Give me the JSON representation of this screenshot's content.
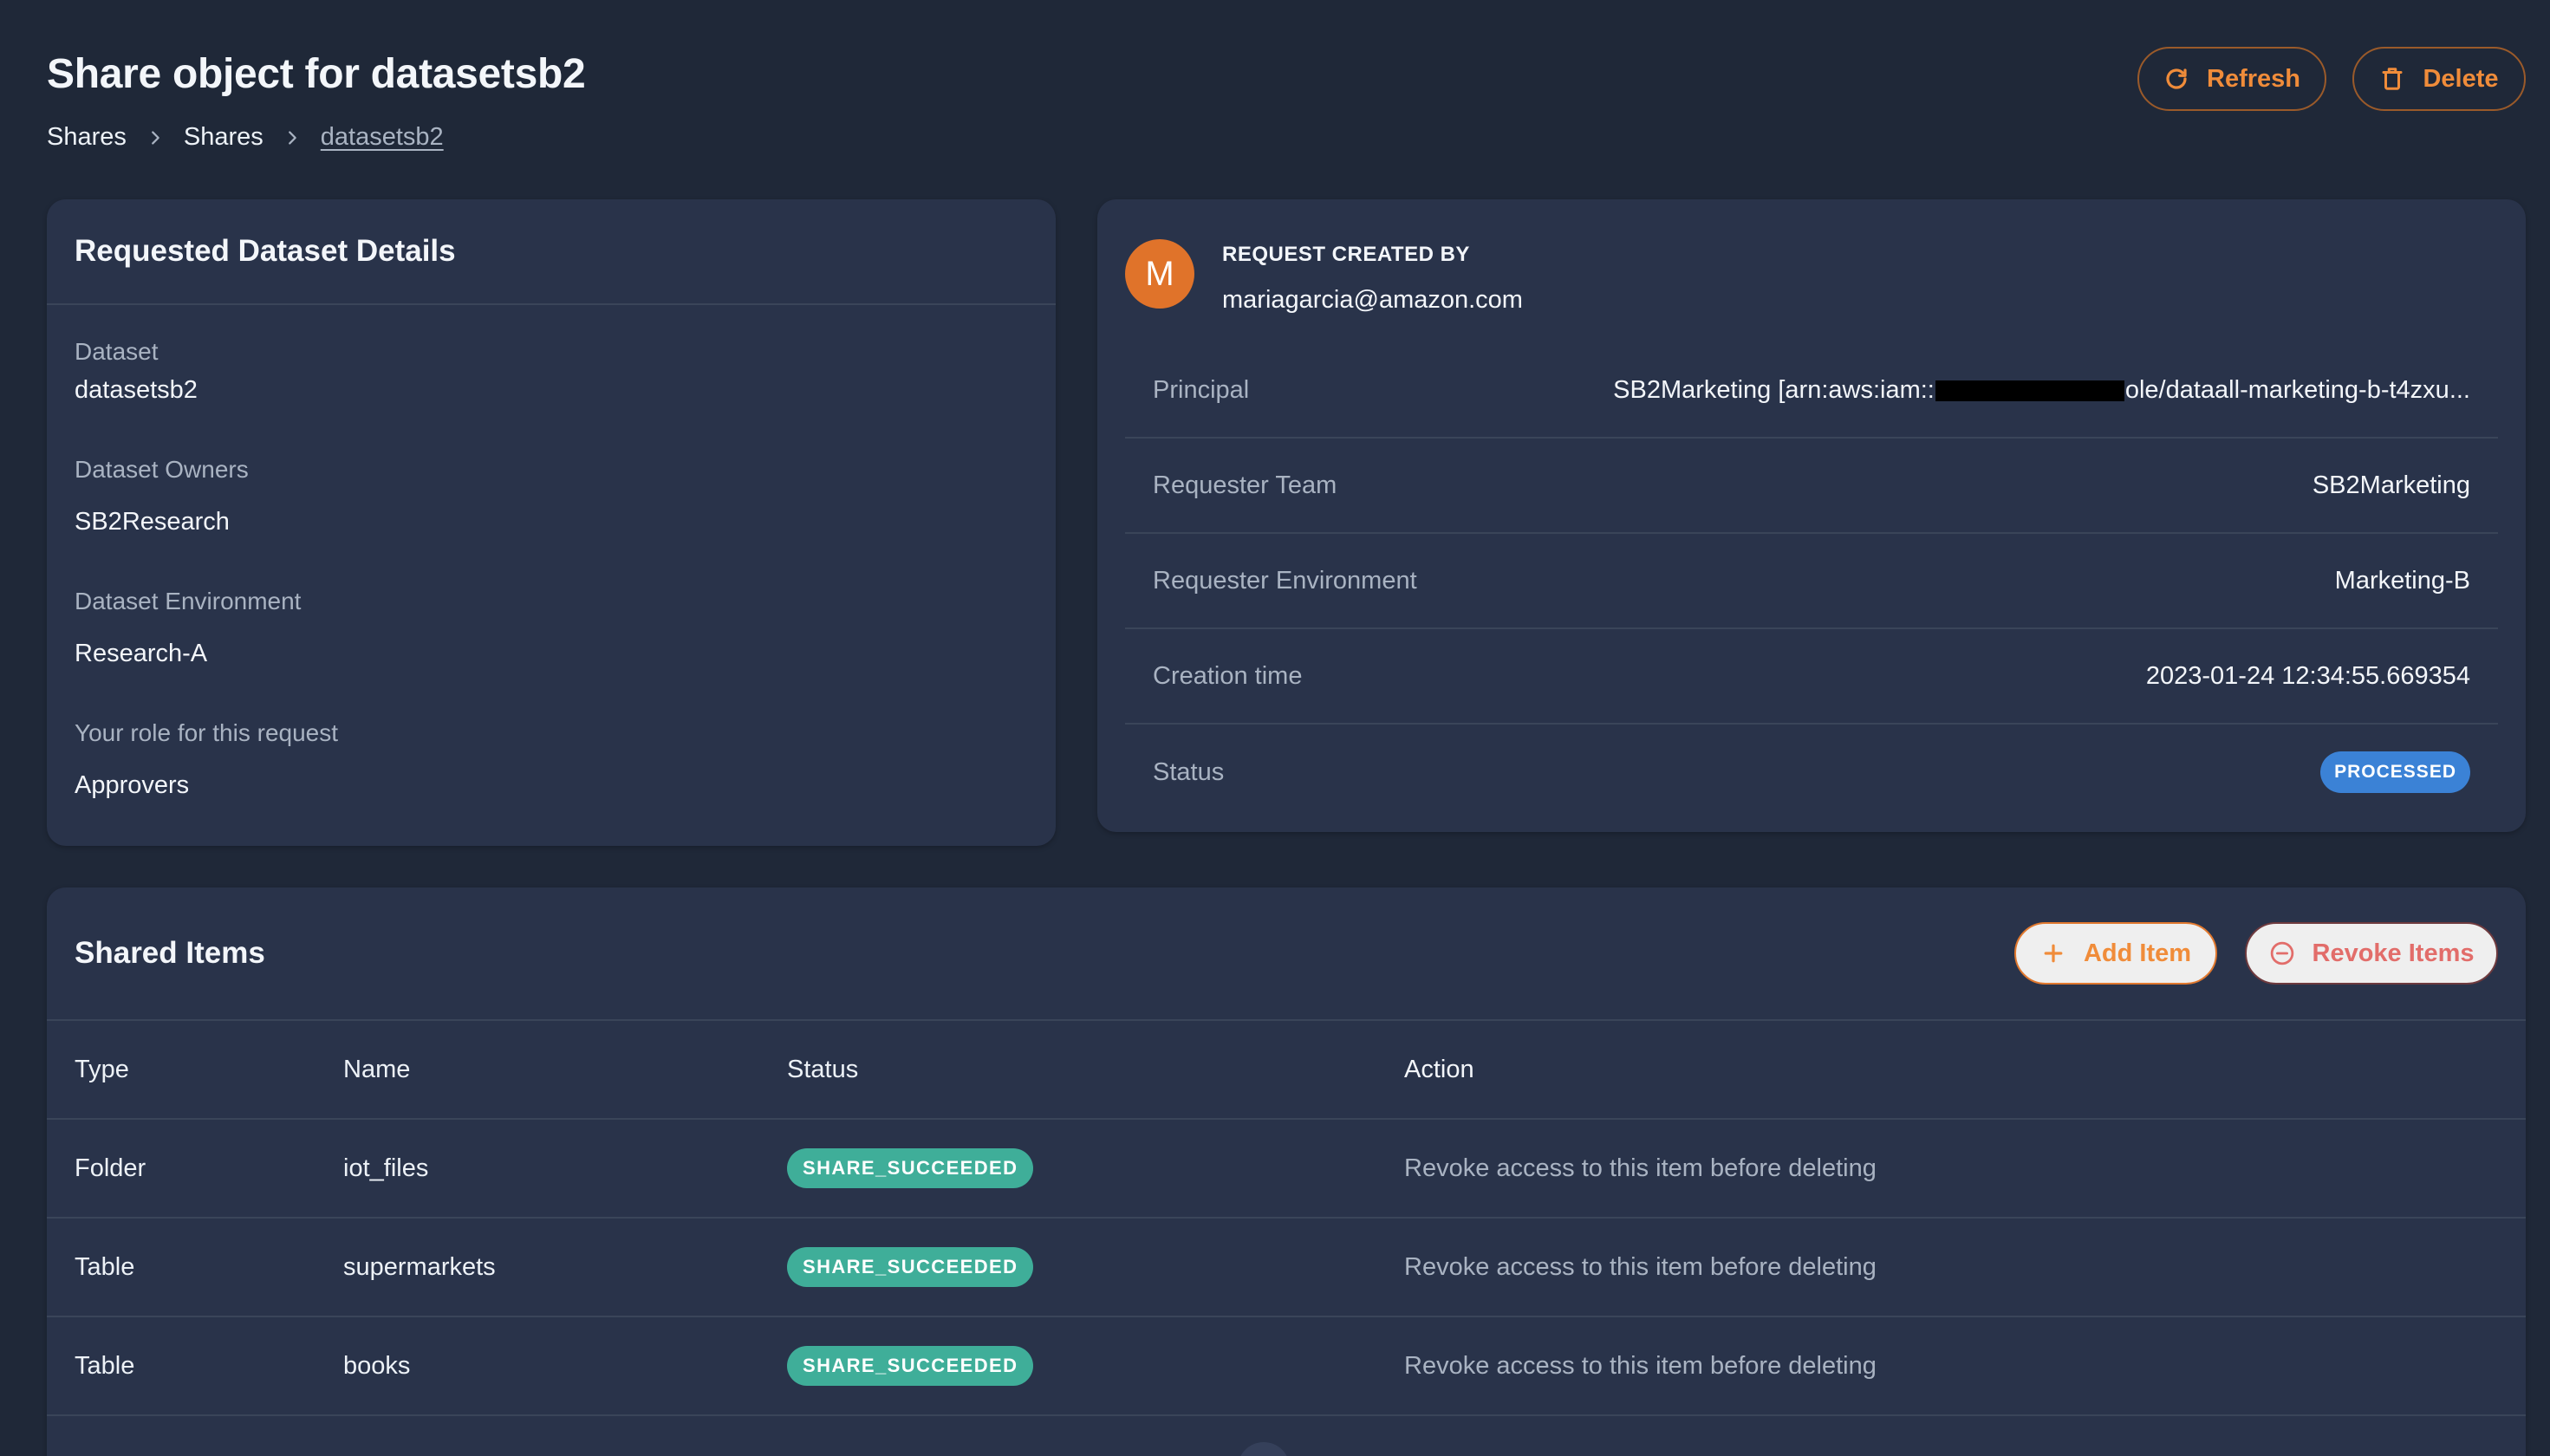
{
  "header": {
    "title": "Share object for datasetsb2",
    "breadcrumb": [
      "Shares",
      "Shares",
      "datasetsb2"
    ],
    "refresh_label": "Refresh",
    "delete_label": "Delete"
  },
  "details": {
    "title": "Requested Dataset Details",
    "fields": [
      {
        "label": "Dataset",
        "value": "datasetsb2"
      },
      {
        "label": "Dataset Owners",
        "value": "SB2Research"
      },
      {
        "label": "Dataset Environment",
        "value": "Research-A"
      },
      {
        "label": "Your role for this request",
        "value": "Approvers"
      }
    ]
  },
  "request": {
    "avatar_letter": "M",
    "caption": "REQUEST CREATED BY",
    "email": "mariagarcia@amazon.com",
    "principal_label": "Principal",
    "principal_prefix": "SB2Marketing [arn:aws:iam::",
    "principal_suffix": "ole/dataall-marketing-b-t4zxu...",
    "team_label": "Requester Team",
    "team_value": "SB2Marketing",
    "env_label": "Requester Environment",
    "env_value": "Marketing-B",
    "time_label": "Creation time",
    "time_value": "2023-01-24 12:34:55.669354",
    "status_label": "Status",
    "status_value": "PROCESSED",
    "status_color": "#3b82d6"
  },
  "items": {
    "title": "Shared Items",
    "add_label": "Add Item",
    "revoke_label": "Revoke Items",
    "columns": [
      "Type",
      "Name",
      "Status",
      "Action"
    ],
    "rows": [
      {
        "type": "Folder",
        "name": "iot_files",
        "status": "SHARE_SUCCEEDED",
        "action": "Revoke access to this item before deleting"
      },
      {
        "type": "Table",
        "name": "supermarkets",
        "status": "SHARE_SUCCEEDED",
        "action": "Revoke access to this item before deleting"
      },
      {
        "type": "Table",
        "name": "books",
        "status": "SHARE_SUCCEEDED",
        "action": "Revoke access to this item before deleting"
      }
    ],
    "status_color": "#3fae99"
  },
  "colors": {
    "background": "#1f2838",
    "card": "#29334a",
    "accent": "#f08c3a",
    "danger": "#e26d6a"
  }
}
